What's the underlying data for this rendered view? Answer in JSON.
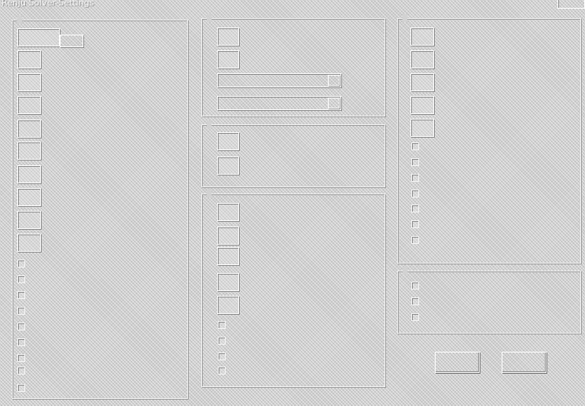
{
  "window": {
    "title": "Renju Solver-Settings",
    "close_label": ""
  },
  "groups": {
    "col1": "",
    "col2a": "",
    "col2b": "",
    "col2c": "",
    "col3a": "",
    "col3b": ""
  },
  "col1": {
    "spin_labels": [
      "",
      "",
      "",
      "",
      "",
      "",
      "",
      "",
      "",
      ""
    ],
    "check_labels": [
      "",
      "",
      "",
      "",
      "",
      "",
      "",
      "",
      ""
    ]
  },
  "col2": {
    "top_labels": [
      "",
      ""
    ],
    "combo1_value": "",
    "combo2_value": "",
    "mid_labels": [
      "",
      ""
    ],
    "bottom_spin_labels": [
      "",
      "",
      "",
      "",
      ""
    ],
    "bottom_check_labels": [
      "",
      "",
      "",
      ""
    ]
  },
  "col3": {
    "spin_labels": [
      "",
      "",
      "",
      "",
      ""
    ],
    "check_labels": [
      "",
      "",
      "",
      "",
      "",
      "",
      ""
    ],
    "lower_check_labels": [
      "",
      "",
      ""
    ]
  },
  "buttons": {
    "ok": "",
    "cancel": ""
  }
}
